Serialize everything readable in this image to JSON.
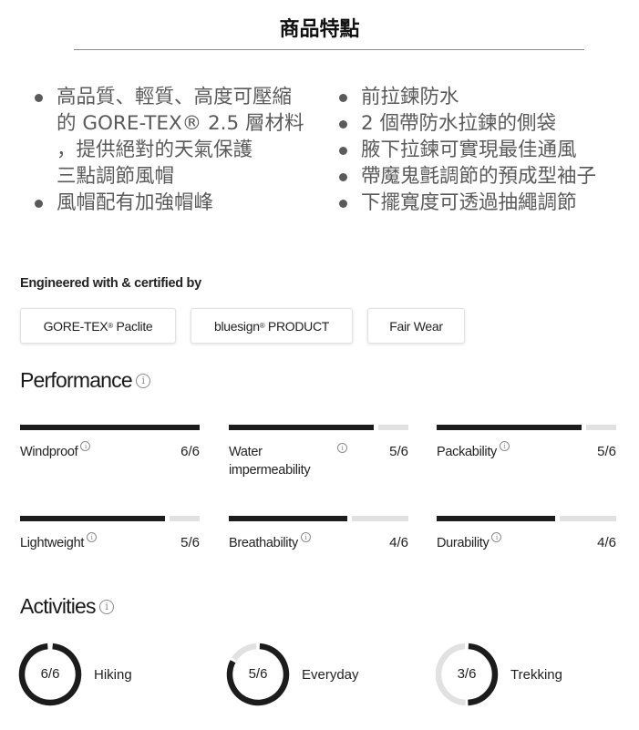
{
  "header": {
    "title": "商品特點"
  },
  "features": {
    "left": [
      {
        "text": "高品質、輕質、高度可壓縮\n的 GORE-TEX® 2.5 層材料\n，提供絕對的天氣保護\n三點調節風帽",
        "bullet": true
      },
      {
        "text": "風帽配有加強帽峰",
        "bullet": true
      }
    ],
    "right": [
      {
        "text": "前拉鍊防水",
        "bullet": true
      },
      {
        "text": "2 個帶防水拉鍊的側袋",
        "bullet": true
      },
      {
        "text": "腋下拉鍊可實現最佳通風",
        "bullet": true
      },
      {
        "text": "帶魔鬼氈調節的預成型袖子",
        "bullet": true
      },
      {
        "text": "下擺寬度可透過抽繩調節",
        "bullet": true
      }
    ]
  },
  "certifications": {
    "heading": "Engineered with & certified by",
    "items": [
      {
        "name": "GORE-TEX",
        "mark": "®",
        "suffix": " Paclite"
      },
      {
        "name": "bluesign",
        "mark": "®",
        "suffix": " PRODUCT"
      },
      {
        "name": "Fair Wear",
        "mark": "",
        "suffix": ""
      }
    ]
  },
  "performance": {
    "title": "Performance",
    "info_icon": "info-icon",
    "max": 6,
    "items": [
      {
        "label": "Windproof",
        "value": 6,
        "display": "6/6"
      },
      {
        "label": "Water impermeability",
        "value": 5,
        "display": "5/6"
      },
      {
        "label": "Packability",
        "value": 5,
        "display": "5/6"
      },
      {
        "label": "Lightweight",
        "value": 5,
        "display": "5/6"
      },
      {
        "label": "Breathability",
        "value": 4,
        "display": "4/6"
      },
      {
        "label": "Durability",
        "value": 4,
        "display": "4/6"
      }
    ]
  },
  "activities": {
    "title": "Activities",
    "info_icon": "info-icon",
    "max": 6,
    "items": [
      {
        "label": "Hiking",
        "value": 6,
        "display": "6/6"
      },
      {
        "label": "Everyday",
        "value": 5,
        "display": "5/6"
      },
      {
        "label": "Trekking",
        "value": 3,
        "display": "3/6"
      }
    ]
  },
  "colors": {
    "filled": "#1c1c1c",
    "empty": "#e1e1e1",
    "feature_text": "#5a5a5a"
  }
}
